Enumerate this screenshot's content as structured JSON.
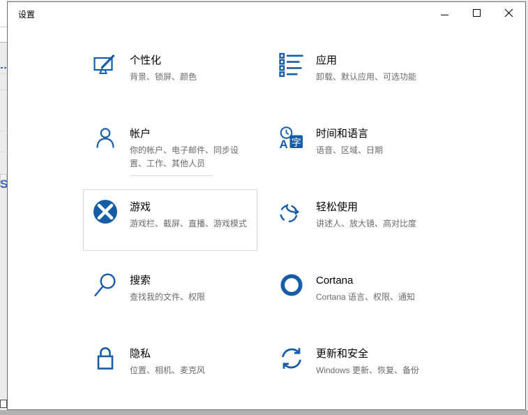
{
  "window": {
    "title": "设置",
    "controls": {
      "minimize_icon": "minimize-icon",
      "maximize_icon": "maximize-icon",
      "close_icon": "close-icon",
      "close_glyph": "✕"
    }
  },
  "categories": [
    {
      "title": "个性化",
      "subtitle": "背景、锁屏、颜色",
      "icon": "personalization-monitor-brush-icon",
      "highlighted": false
    },
    {
      "title": "应用",
      "subtitle": "卸载、默认应用、可选功能",
      "icon": "apps-list-icon",
      "highlighted": false
    },
    {
      "title": "帐户",
      "subtitle": "你的帐户、电子邮件、同步设置、工作、其他人员",
      "icon": "accounts-person-icon",
      "highlighted": false
    },
    {
      "title": "时间和语言",
      "subtitle": "语音、区域、日期",
      "icon": "time-language-clock-icon",
      "highlighted": false
    },
    {
      "title": "游戏",
      "subtitle": "游戏栏、截屏、直播、游戏模式",
      "icon": "gaming-xbox-icon",
      "highlighted": true
    },
    {
      "title": "轻松使用",
      "subtitle": "讲述人、放大镜、高对比度",
      "icon": "ease-of-access-icon",
      "highlighted": false
    },
    {
      "title": "搜索",
      "subtitle": "查找我的文件、权限",
      "icon": "search-magnifier-icon",
      "highlighted": false
    },
    {
      "title": "Cortana",
      "subtitle": "Cortana 语言、权限、通知",
      "icon": "cortana-ring-icon",
      "highlighted": false
    },
    {
      "title": "隐私",
      "subtitle": "位置、相机、麦克风",
      "icon": "privacy-lock-icon",
      "highlighted": false
    },
    {
      "title": "更新和安全",
      "subtitle": "Windows 更新、恢复、备份",
      "icon": "update-security-refresh-icon",
      "highlighted": false
    }
  ],
  "background": {
    "partial_text": "S"
  },
  "colors": {
    "icon_blue": "#175CA6",
    "title_text": "#000000",
    "subtitle_gray": "#6b6b6b",
    "highlight_border": "#d2d2d2",
    "window_border": "#6e6e6e",
    "desktop_gray": "#e9e9e9"
  }
}
